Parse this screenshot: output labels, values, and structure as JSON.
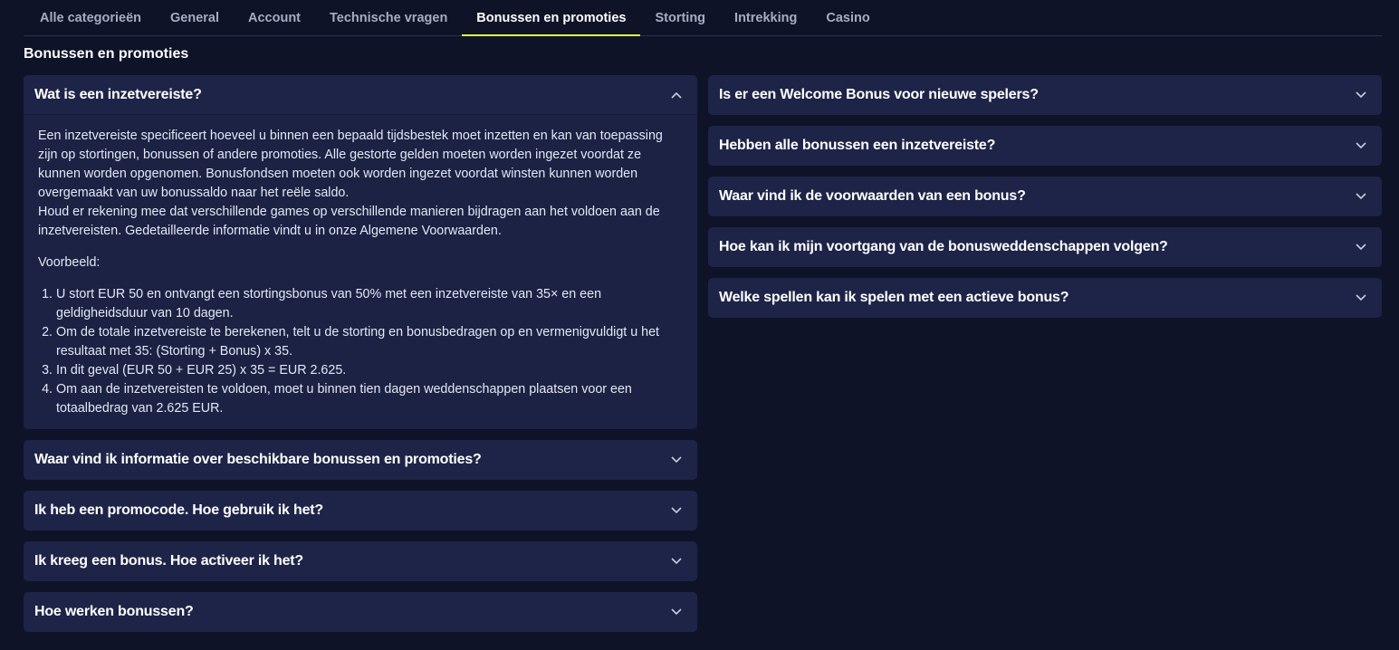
{
  "tabs": [
    {
      "label": "Alle categorieën",
      "active": false
    },
    {
      "label": "General",
      "active": false
    },
    {
      "label": "Account",
      "active": false
    },
    {
      "label": "Technische vragen",
      "active": false
    },
    {
      "label": "Bonussen en promoties",
      "active": true
    },
    {
      "label": "Storting",
      "active": false
    },
    {
      "label": "Intrekking",
      "active": false
    },
    {
      "label": "Casino",
      "active": false
    }
  ],
  "section_title": "Bonussen en promoties",
  "accent_color": "#e8ff3a",
  "icons": {
    "expanded": "chevron-up-icon",
    "collapsed": "chevron-down-icon"
  },
  "left": {
    "open_item": {
      "title": "Wat is een inzetvereiste?",
      "para1": "Een inzetvereiste specificeert hoeveel u binnen een bepaald tijdsbestek moet inzetten en kan van toepassing zijn op stortingen, bonussen of andere promoties. Alle gestorte gelden moeten worden ingezet voordat ze kunnen worden opgenomen. Bonusfondsen moeten ook worden ingezet voordat winsten kunnen worden overgemaakt van uw bonussaldo naar het reële saldo.",
      "para2": "Houd er rekening mee dat verschillende games op verschillende manieren bijdragen aan het voldoen aan de inzetvereisten. Gedetailleerde informatie vindt u in onze Algemene Voorwaarden.",
      "example_label": "Voorbeeld:",
      "steps": [
        "U stort EUR 50 en ontvangt een stortingsbonus van 50% met een inzetvereiste van 35× en een geldigheidsduur van 10 dagen.",
        "Om de totale inzetvereiste te berekenen, telt u de storting en bonusbedragen op en vermenigvuldigt u het resultaat met 35: (Storting + Bonus) x 35.",
        "In dit geval (EUR 50 + EUR 25) x 35 = EUR 2.625.",
        "Om aan de inzetvereisten te voldoen, moet u binnen tien dagen weddenschappen plaatsen voor een totaalbedrag van 2.625 EUR."
      ]
    },
    "items": [
      "Waar vind ik informatie over beschikbare bonussen en promoties?",
      "Ik heb een promocode. Hoe gebruik ik het?",
      "Ik kreeg een bonus. Hoe activeer ik het?",
      "Hoe werken bonussen?"
    ]
  },
  "right": {
    "items": [
      "Is er een Welcome Bonus voor nieuwe spelers?",
      "Hebben alle bonussen een inzetvereiste?",
      "Waar vind ik de voorwaarden van een bonus?",
      "Hoe kan ik mijn voortgang van de bonusweddenschappen volgen?",
      "Welke spellen kan ik spelen met een actieve bonus?"
    ]
  }
}
